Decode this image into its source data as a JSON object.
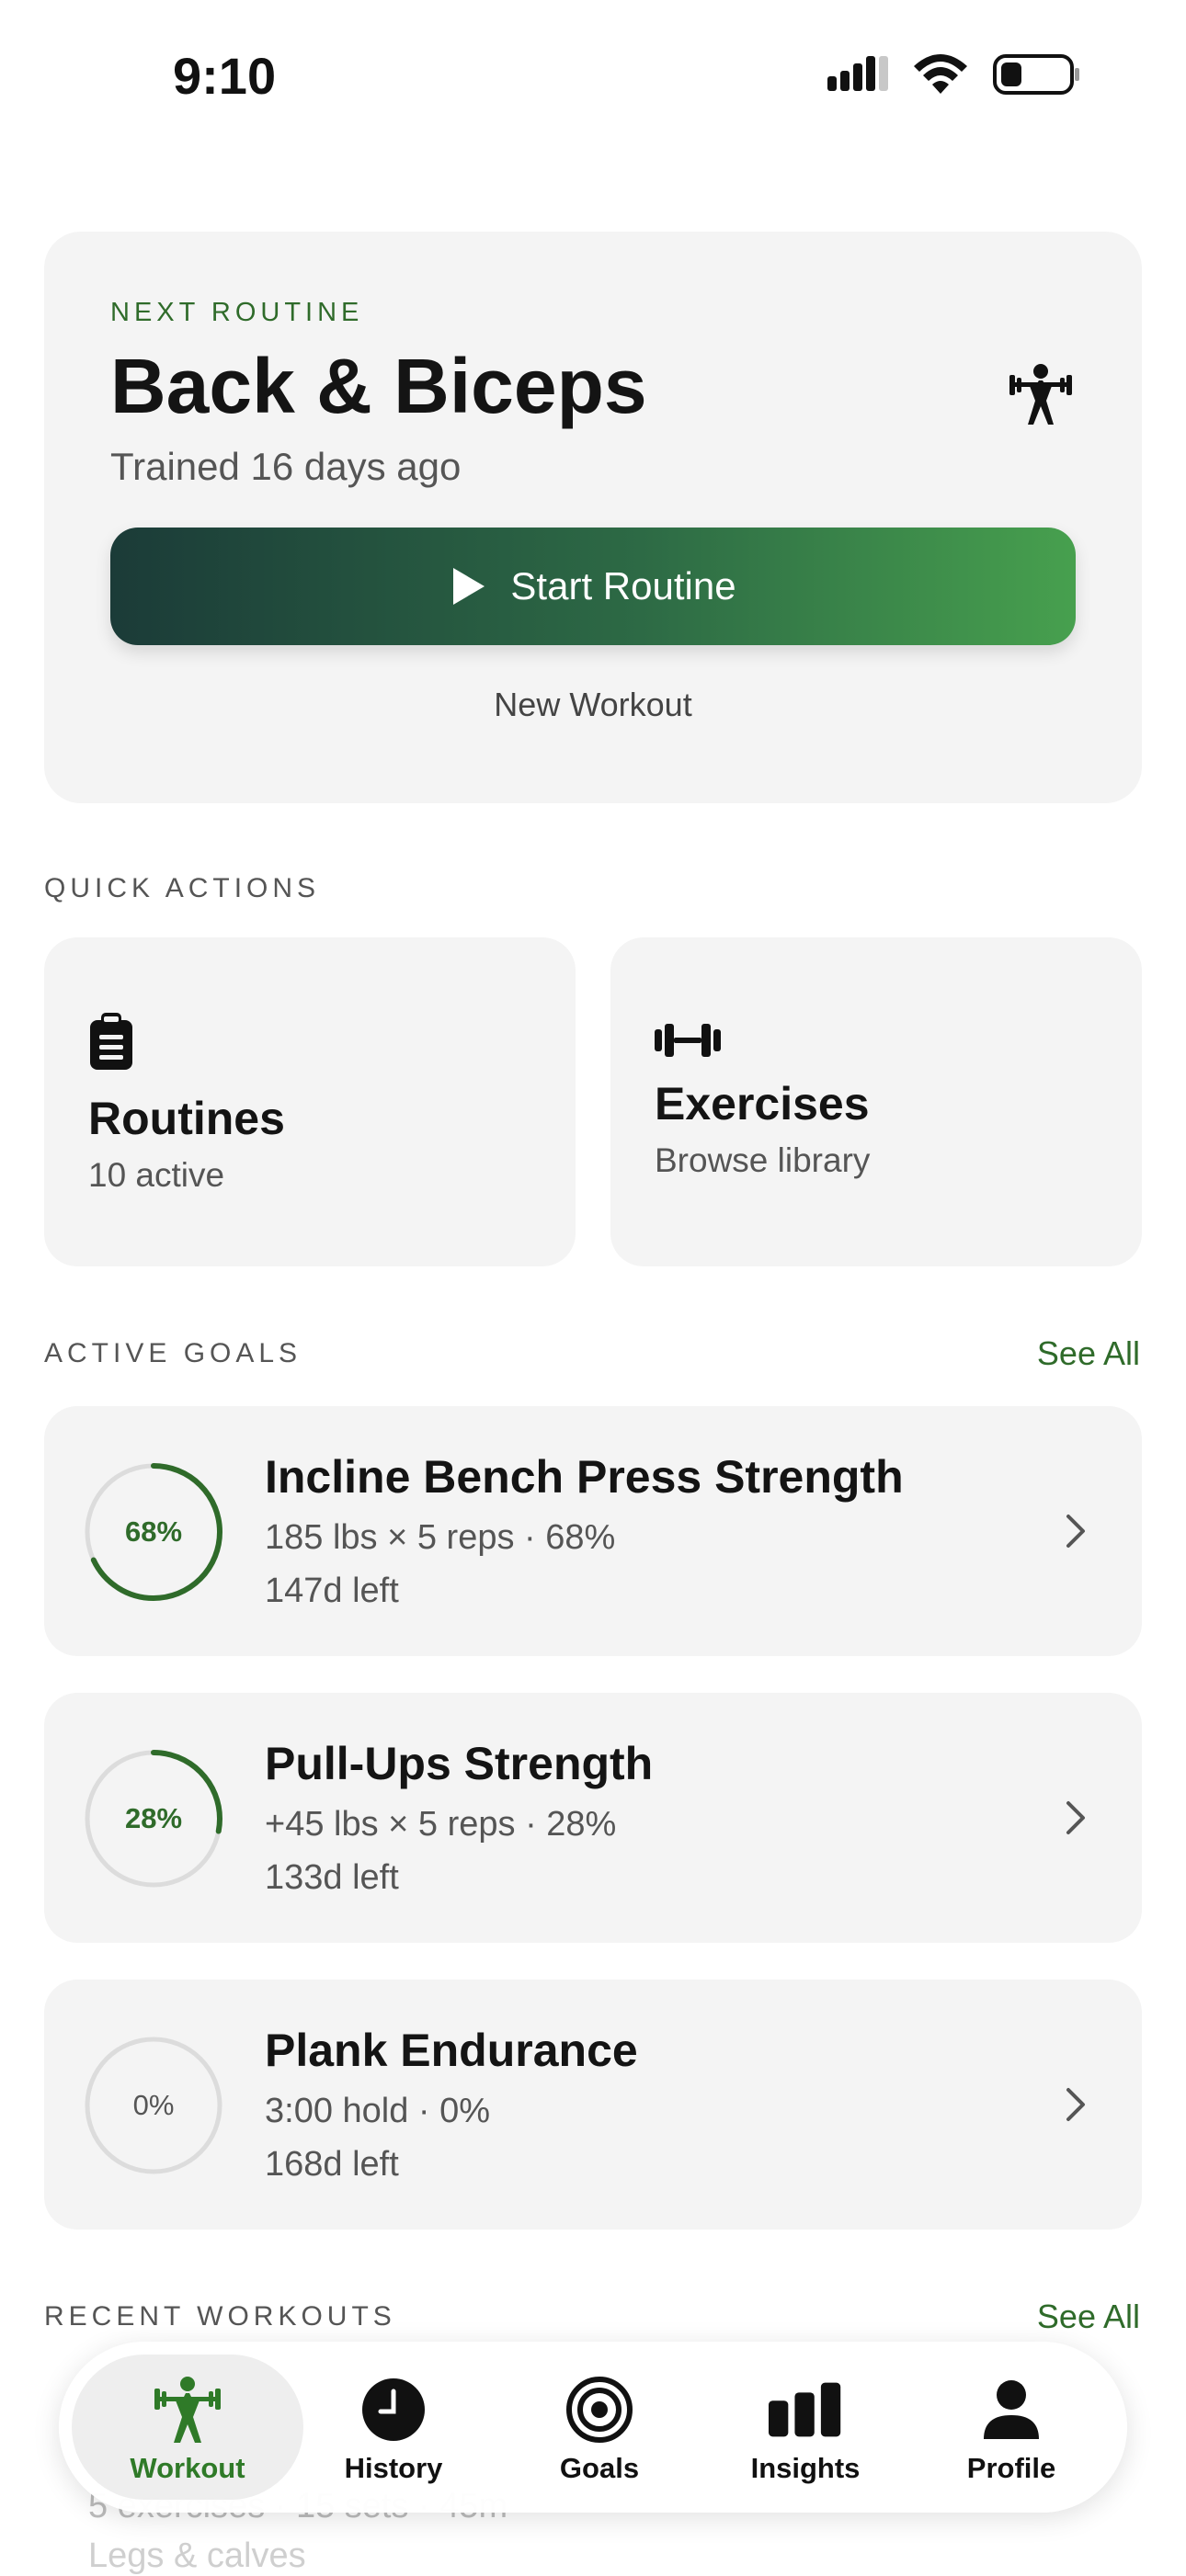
{
  "status_bar": {
    "time": "9:10"
  },
  "hero": {
    "eyebrow": "NEXT ROUTINE",
    "title": "Back & Biceps",
    "subtitle": "Trained 16 days ago",
    "start_label": "Start Routine",
    "secondary_label": "New Workout"
  },
  "quick_actions": {
    "label": "QUICK ACTIONS",
    "items": [
      {
        "title": "Routines",
        "subtitle": "10 active",
        "icon": "clipboard-icon"
      },
      {
        "title": "Exercises",
        "subtitle": "Browse library",
        "icon": "dumbbell-icon"
      }
    ]
  },
  "active_goals": {
    "label": "ACTIVE GOALS",
    "see_all": "See All",
    "items": [
      {
        "percent_label": "68%",
        "progress": 0.68,
        "title": "Incline Bench Press Strength",
        "meta": "185 lbs × 5 reps · 68%",
        "left": "147d left"
      },
      {
        "percent_label": "28%",
        "progress": 0.28,
        "title": "Pull-Ups Strength",
        "meta": "+45 lbs × 5 reps · 28%",
        "left": "133d left"
      },
      {
        "percent_label": "0%",
        "progress": 0.0,
        "title": "Plank Endurance",
        "meta": "3:00 hold · 0%",
        "left": "168d left"
      }
    ]
  },
  "recent_workouts": {
    "label": "RECENT WORKOUTS",
    "see_all": "See All",
    "peek_line1": "5 exercises · 15 sets · 45m",
    "peek_line2": "Legs & calves"
  },
  "tabbar": {
    "items": [
      {
        "label": "Workout",
        "icon": "lifter-icon",
        "active": true
      },
      {
        "label": "History",
        "icon": "clock-icon"
      },
      {
        "label": "Goals",
        "icon": "target-icon"
      },
      {
        "label": "Insights",
        "icon": "bar-chart-icon"
      },
      {
        "label": "Profile",
        "icon": "person-icon"
      }
    ]
  },
  "colors": {
    "accent": "#2f6b2a",
    "card": "#f4f4f4",
    "ring_track": "#dcdcdc"
  }
}
